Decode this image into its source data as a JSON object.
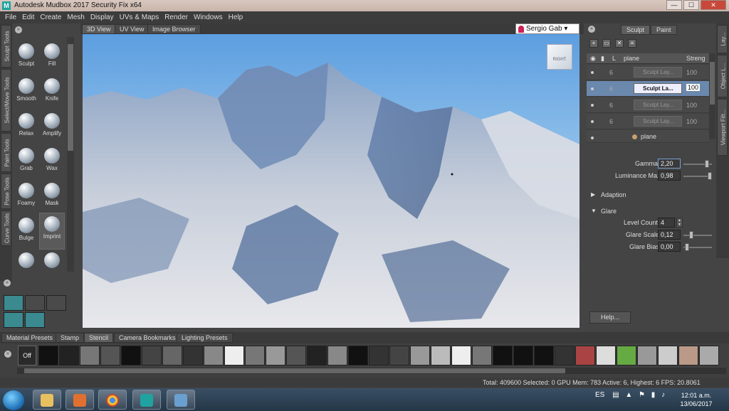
{
  "window": {
    "title": "Autodesk Mudbox 2017 Security Fix x64",
    "logo": "M"
  },
  "menu": [
    "File",
    "Edit",
    "Create",
    "Mesh",
    "Display",
    "UVs & Maps",
    "Render",
    "Windows",
    "Help"
  ],
  "left_tabs": [
    "Sculpt Tools",
    "Select/Move Tools",
    "Paint Tools",
    "Pose Tools",
    "Curve Tools"
  ],
  "tools": [
    {
      "label": "Sculpt",
      "icon": "sculpt-tool-icon"
    },
    {
      "label": "Fill",
      "icon": "fill-tool-icon"
    },
    {
      "label": "Smooth",
      "icon": "smooth-tool-icon"
    },
    {
      "label": "Knife",
      "icon": "knife-tool-icon"
    },
    {
      "label": "Relax",
      "icon": "relax-tool-icon"
    },
    {
      "label": "Amplify",
      "icon": "amplify-tool-icon"
    },
    {
      "label": "Grab",
      "icon": "grab-tool-icon"
    },
    {
      "label": "Wax",
      "icon": "wax-tool-icon"
    },
    {
      "label": "Foamy",
      "icon": "foamy-tool-icon"
    },
    {
      "label": "Mask",
      "icon": "mask-tool-icon"
    },
    {
      "label": "Bulge",
      "icon": "bulge-tool-icon"
    },
    {
      "label": "Imprint",
      "icon": "imprint-tool-icon"
    }
  ],
  "viewport_tabs": [
    "3D View",
    "UV View",
    "Image Browser"
  ],
  "user": {
    "name": "Sergio Gab"
  },
  "viewcube_label": "RIGHT",
  "right_panel": {
    "modes": [
      "Sculpt",
      "Paint"
    ],
    "layer_headers": {
      "level": "L",
      "name": "plane",
      "strength": "Streng"
    },
    "layers": [
      {
        "level": "6",
        "name": "Sculpt Lay...",
        "strength": "100",
        "selected": false
      },
      {
        "level": "6",
        "name": "Sculpt La...",
        "strength": "100",
        "selected": true
      },
      {
        "level": "6",
        "name": "Sculpt Lay...",
        "strength": "100",
        "selected": false
      },
      {
        "level": "6",
        "name": "Sculpt Lay...",
        "strength": "100",
        "selected": false
      }
    ],
    "base_layer": "plane",
    "gamma": {
      "label": "Gamma",
      "value": "2,20"
    },
    "luminance_max": {
      "label": "Luminance Max",
      "value": "0,98"
    },
    "adaption_label": "Adaption",
    "glare_label": "Glare",
    "level_count": {
      "label": "Level Count",
      "value": "4"
    },
    "glare_scale": {
      "label": "Glare Scale",
      "value": "0,12"
    },
    "glare_bias": {
      "label": "Glare Bias",
      "value": "0,00"
    },
    "help_label": "Help..."
  },
  "right_tabs": [
    "Lay...",
    "Object L...",
    "Viewport Filt..."
  ],
  "bottom_tabs": [
    "Material Presets",
    "Stamp",
    "Stencil",
    "Camera Bookmarks",
    "Lighting Presets"
  ],
  "off_label": "Off",
  "status": "Total: 409600  Selected: 0 GPU Mem: 783  Active: 6, Highest: 6  FPS: 20.8061",
  "taskbar": {
    "lang": "ES",
    "time": "12:01 a.m.",
    "date": "13/06/2017"
  },
  "colors": {
    "accent_selection": "#6b88ad",
    "sky": "#5c9ee0",
    "falloff": "#3a8a90"
  }
}
